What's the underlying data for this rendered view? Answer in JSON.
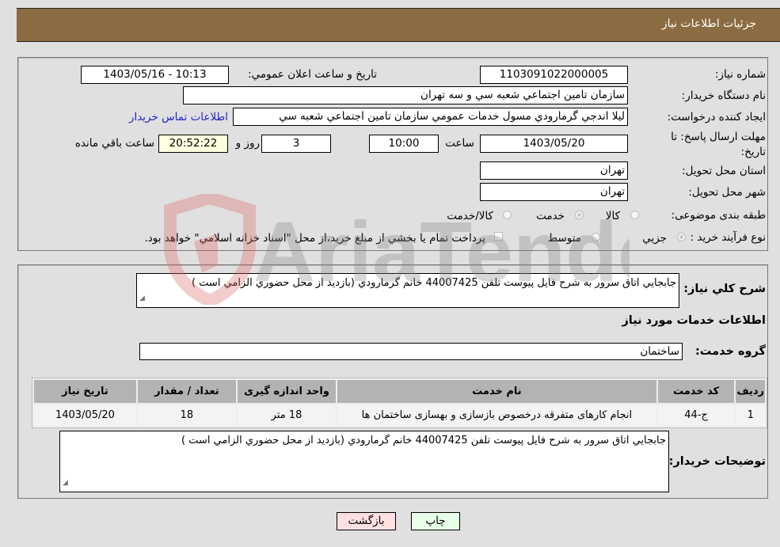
{
  "header": {
    "title": "جزئيات اطلاعات نياز"
  },
  "fields": {
    "need_number": {
      "label": "شماره نياز:",
      "value": "1103091022000005"
    },
    "announce_datetime": {
      "label": "تاريخ و ساعت اعلان عمومي:",
      "value": "1403/05/16 - 10:13"
    },
    "buyer_org": {
      "label": "نام دستگاه خريدار:",
      "value": "سازمان تامين اجتماعي شعبه سي و سه تهران"
    },
    "requester": {
      "label": "ايجاد کننده درخواست:",
      "value": "ليلا اندجي گرمارودي مسول خدمات عمومي سازمان تامين اجتماعي شعبه سي",
      "contact_link": "اطلاعات تماس خريدار"
    },
    "deadline": {
      "label": "مهلت ارسال پاسخ: تا تاريخ:",
      "date": "1403/05/20",
      "time_label": "ساعت",
      "time": "10:00",
      "days": "3",
      "days_label": "روز و",
      "remaining": "20:52:22",
      "remaining_label": "ساعت باقي مانده"
    },
    "province": {
      "label": "استان محل تحويل:",
      "value": "تهران"
    },
    "city": {
      "label": "شهر محل تحويل:",
      "value": "تهران"
    },
    "category": {
      "label": "طبقه بندی موضوعی:",
      "options": [
        "کالا",
        "خدمت",
        "کالا/خدمت"
      ],
      "selected": "خدمت"
    },
    "purchase_type": {
      "label": "نوع فرآيند خريد :",
      "options": [
        "جزيي",
        "متوسط"
      ],
      "selected": "جزيي",
      "treasury_note": "پرداخت تمام يا بخشي از مبلغ خريد،از محل \"اسناد خزانه اسلامي\" خواهد بود."
    }
  },
  "description": {
    "label": "شرح کلي نياز:",
    "value": "جابجايي اتاق سرور به شرح فايل پيوست تلفن 44007425 خانم گرمارودي  (بازديد از محل حضوري الزامي است )"
  },
  "services": {
    "section_title": "اطلاعات خدمات مورد نياز",
    "group_label": "گروه خدمت:",
    "group_value": "ساختمان",
    "table": {
      "headers": [
        "رديف",
        "کد خدمت",
        "نام خدمت",
        "واحد اندازه گيری",
        "تعداد / مقدار",
        "تاريخ نياز"
      ],
      "rows": [
        [
          "1",
          "ج-44",
          "انجام کارهای متفرقه درخصوص بازسازی و بهسازی ساختمان ها",
          "18 متر",
          "18",
          "1403/05/20"
        ]
      ]
    }
  },
  "buyer_notes": {
    "label": "توضيحات خريدار:",
    "value": "جابجايي اتاق سرور به شرح فايل پيوست تلفن 44007425 خانم گرمارودي  (بازديد از محل حضوري الزامي است )"
  },
  "buttons": {
    "print": "چاپ",
    "back": "بازگشت"
  },
  "watermark": {
    "text": "AriaTender.neT"
  },
  "colors": {
    "header_bg": "#8b6b41",
    "page_bg": "#e0e0e0",
    "remaining_bg": "#ffffe0",
    "link": "#2222cc",
    "back_btn": "#ffe0e0",
    "print_btn": "#e8ffe8"
  }
}
